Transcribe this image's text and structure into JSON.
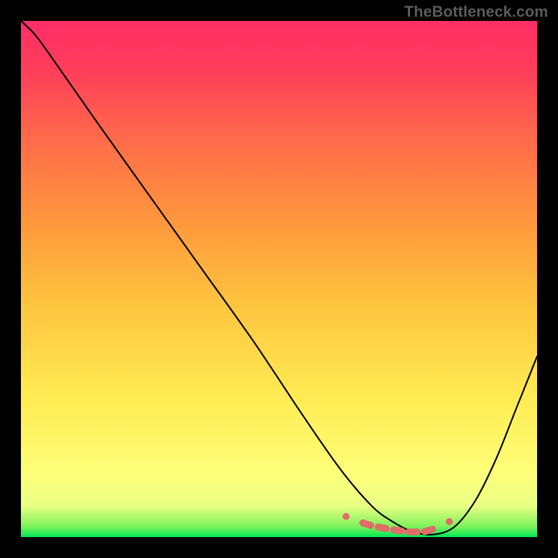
{
  "watermark": "TheBottleneck.com",
  "colors": {
    "background": "#000000",
    "curve": "#000000",
    "marker": "#de6d6a",
    "gradient_stops": [
      "#00e756",
      "#7cf25a",
      "#e9ff84",
      "#fdff7a",
      "#ffed55",
      "#ffc73f",
      "#ff9a3c",
      "#ff6e49",
      "#ff3f5a",
      "#ff2d66"
    ]
  },
  "chart_data": {
    "type": "line",
    "title": "",
    "xlabel": "",
    "ylabel": "",
    "xlim": [
      0,
      100
    ],
    "ylim": [
      0,
      100
    ],
    "grid": false,
    "legend": false,
    "series": [
      {
        "name": "bottleneck-curve",
        "x": [
          0,
          3,
          8,
          15,
          25,
          35,
          45,
          55,
          62,
          68,
          72,
          76,
          80,
          84,
          88,
          92,
          96,
          100
        ],
        "y": [
          100,
          97,
          90,
          80,
          66,
          52,
          38,
          23,
          13,
          6,
          3,
          1,
          0.5,
          2,
          7,
          15,
          25,
          35
        ]
      }
    ],
    "markers": {
      "name": "highlighted-region",
      "shape": "rounded-capsule",
      "x": [
        63,
        67,
        70,
        73,
        76,
        79,
        83
      ],
      "y": [
        4.0,
        2.5,
        1.8,
        1.3,
        1.0,
        1.3,
        3.0
      ]
    }
  }
}
